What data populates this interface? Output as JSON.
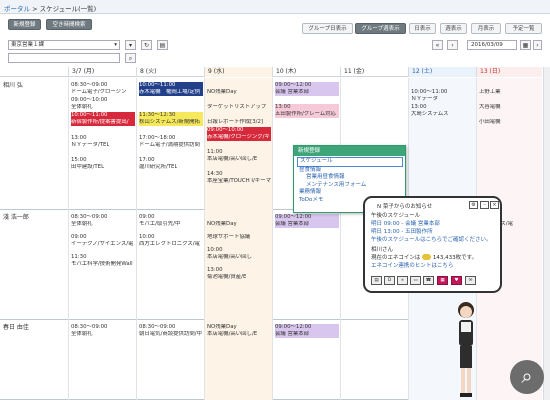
{
  "breadcrumb": {
    "home": "ポータル",
    "sep": " > ",
    "current": "スケジュール(一覧)"
  },
  "toolbar": {
    "new_label": "新規登録",
    "search_label": "空き時間検索"
  },
  "views": [
    {
      "label": "グループ日表示",
      "active": false
    },
    {
      "label": "グループ週表示",
      "active": true
    },
    {
      "label": "日表示",
      "active": false
    },
    {
      "label": "週表示",
      "active": false
    },
    {
      "label": "月表示",
      "active": false
    },
    {
      "label": "予定一覧",
      "active": false
    }
  ],
  "group_select": "東京営業１課",
  "date_value": "2016/03/09",
  "days": [
    {
      "label": "3/7 (月)",
      "kind": "normal"
    },
    {
      "label": "8 (火)",
      "kind": "normal"
    },
    {
      "label": "9 (水)",
      "kind": "today"
    },
    {
      "label": "10 (木)",
      "kind": "normal"
    },
    {
      "label": "11 (金)",
      "kind": "normal"
    },
    {
      "label": "12 (土)",
      "kind": "sat"
    },
    {
      "label": "13 (日)",
      "kind": "sun"
    }
  ],
  "users": [
    {
      "name": "相川 弘"
    },
    {
      "name": "淺 浩一郎"
    },
    {
      "name": "春日 由佳"
    }
  ],
  "events": {
    "u0": {
      "mon": [
        "08:30〜09:00",
        "ドーム電子/クロージン",
        "09:00〜10:00",
        "全体朝礼",
        "10:00〜11:00",
        "新宿製作所/提案書提出/",
        "13:00",
        "ＮＹデータ/TEL",
        "15:00",
        "田中建設/TEL"
      ],
      "tue": [
        "10:00〜11:00",
        "赤木電機　権岡工場/定例",
        "11:30〜12:30",
        "秋山システムズ/新規開拓",
        "17:00〜18:00",
        "ドーム電子/満期提供訪問",
        "17:00",
        "瀧川研究所/TEL"
      ],
      "wed": [
        "NO残業Day",
        "ターゲットリストアップ",
        "日報レポート作成[3/2]",
        "09:00〜10:00",
        "赤木電機/クロージング/キ",
        "11:00",
        "本店電機/高い回し/E",
        "14:30",
        "本座宝業/TOUCH I/キーマ"
      ],
      "thu": [
        "09:00〜12:00",
        "会議 営業本部",
        "13:00",
        "五田製作所/クレーム対応"
      ],
      "sat": [
        "10:00〜11:00",
        "ＮＹデータ",
        "13:00",
        "大島システムズ"
      ],
      "sun": [
        "上野工業",
        "大谷電機",
        "小田電機"
      ]
    },
    "u1": {
      "mon": [
        "08:30〜09:00",
        "全体朝礼",
        "09:00",
        "イーテクノ/サイエンス/電",
        "11:30",
        "モバエ科学/技術開発Wall"
      ],
      "tue": [
        "09:00",
        "モバエ/取引先/中",
        "10:00",
        "西方エレクトロニクス/電"
      ],
      "wed": [
        "NO残業Day",
        "地球サポート協議",
        "10:00",
        "本店電機/高い回し",
        "13:00",
        "菊池電機/資産/E"
      ],
      "thu": [
        "09:00〜12:00",
        "会議 営業本部"
      ],
      "sun": [
        "サイエンス/電"
      ]
    },
    "u2": {
      "mon": [
        "08:30〜09:00",
        "全体朝礼"
      ],
      "tue": [
        "08:30〜09:00",
        "朝日電気/商談提供訪問/中"
      ],
      "wed": [
        "NO残業Day",
        "本店電機/高い回し/E"
      ],
      "thu": [
        "09:00〜12:00",
        "会議 営業本部"
      ]
    }
  },
  "context_menu": {
    "title": "新規登録",
    "items": [
      {
        "label": "スケジュール",
        "sub": false
      },
      {
        "label": "昼食情報",
        "sub": false
      },
      {
        "label": "営業用昼食情報",
        "sub": true
      },
      {
        "label": "メンテナンス用フォーム",
        "sub": true
      },
      {
        "label": "業務情報",
        "sub": false
      },
      {
        "label": "ToDoメモ",
        "sub": false
      }
    ]
  },
  "notice": {
    "title": "N 菜子からのお知らせ",
    "line1": "午後のスケジュール",
    "line2": "明日 09:00 - 会議 営業本部",
    "line3": "明日 13:00 - 五田製作所",
    "line4": "午後のスケジュールはこちらでご確認ください。",
    "line5": "相川さん",
    "line6": "現在のエネコインは",
    "coins": "143,433",
    "line6b": "枚です。",
    "line7": "エネコイン連携のヒントはこちら"
  },
  "colors": {
    "accent": "#2a64b0",
    "active_tab": "#6f7a80",
    "today_bg": "#fdf3e6",
    "menu_head": "#3ea579"
  }
}
